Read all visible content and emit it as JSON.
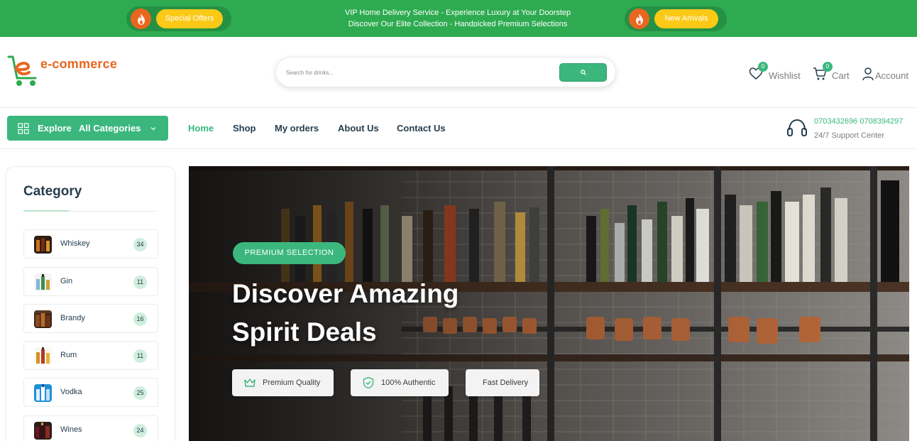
{
  "topbar": {
    "left_tag": "Special Offers",
    "right_tag": "New Arrivals",
    "ticker_lines": [
      "VIP Home Delivery Service - Experience Luxury at Your Doorstep",
      "Discover Our Elite Collection - Handpicked Premium Selections"
    ],
    "colors": {
      "bar": "#2eab50",
      "tag": "#fbc916",
      "fire": "#e9661f"
    }
  },
  "header": {
    "logo_text": "e-commerce",
    "search_placeholder": "Search for drinks...",
    "wishlist": {
      "label": "Wishlist",
      "count": "0"
    },
    "cart": {
      "label": "Cart",
      "count": "0"
    },
    "account": {
      "label": "Account"
    }
  },
  "nav": {
    "category_button": {
      "label_primary": "Explore",
      "label_secondary": "All Categories"
    },
    "links": [
      "Home",
      "Shop",
      "My orders",
      "About Us",
      "Contact Us"
    ],
    "active_link": "Home",
    "support": {
      "phone": "0703432696 0708394297",
      "label": "24/7 Support Center"
    }
  },
  "sidebar": {
    "title": "Category",
    "items": [
      {
        "name": "Whiskey",
        "count": "34",
        "icon": "whiskey-bottle-icon"
      },
      {
        "name": "Gin",
        "count": "11",
        "icon": "gin-bottle-icon"
      },
      {
        "name": "Brandy",
        "count": "16",
        "icon": "brandy-bottle-icon"
      },
      {
        "name": "Rum",
        "count": "11",
        "icon": "rum-bottle-icon"
      },
      {
        "name": "Vodka",
        "count": "25",
        "icon": "vodka-bottle-icon"
      },
      {
        "name": "Wines",
        "count": "24",
        "icon": "wine-bottle-icon"
      }
    ]
  },
  "hero": {
    "badge": "PREMIUM SELECTION",
    "title_line1": "Discover Amazing",
    "title_line2": "Spirit Deals",
    "features": [
      "Premium Quality",
      "100% Authentic",
      "Fast Delivery"
    ]
  },
  "theme": {
    "accent": "#3bb77e",
    "text": "#253d4e",
    "muted": "#7e7e7e"
  }
}
